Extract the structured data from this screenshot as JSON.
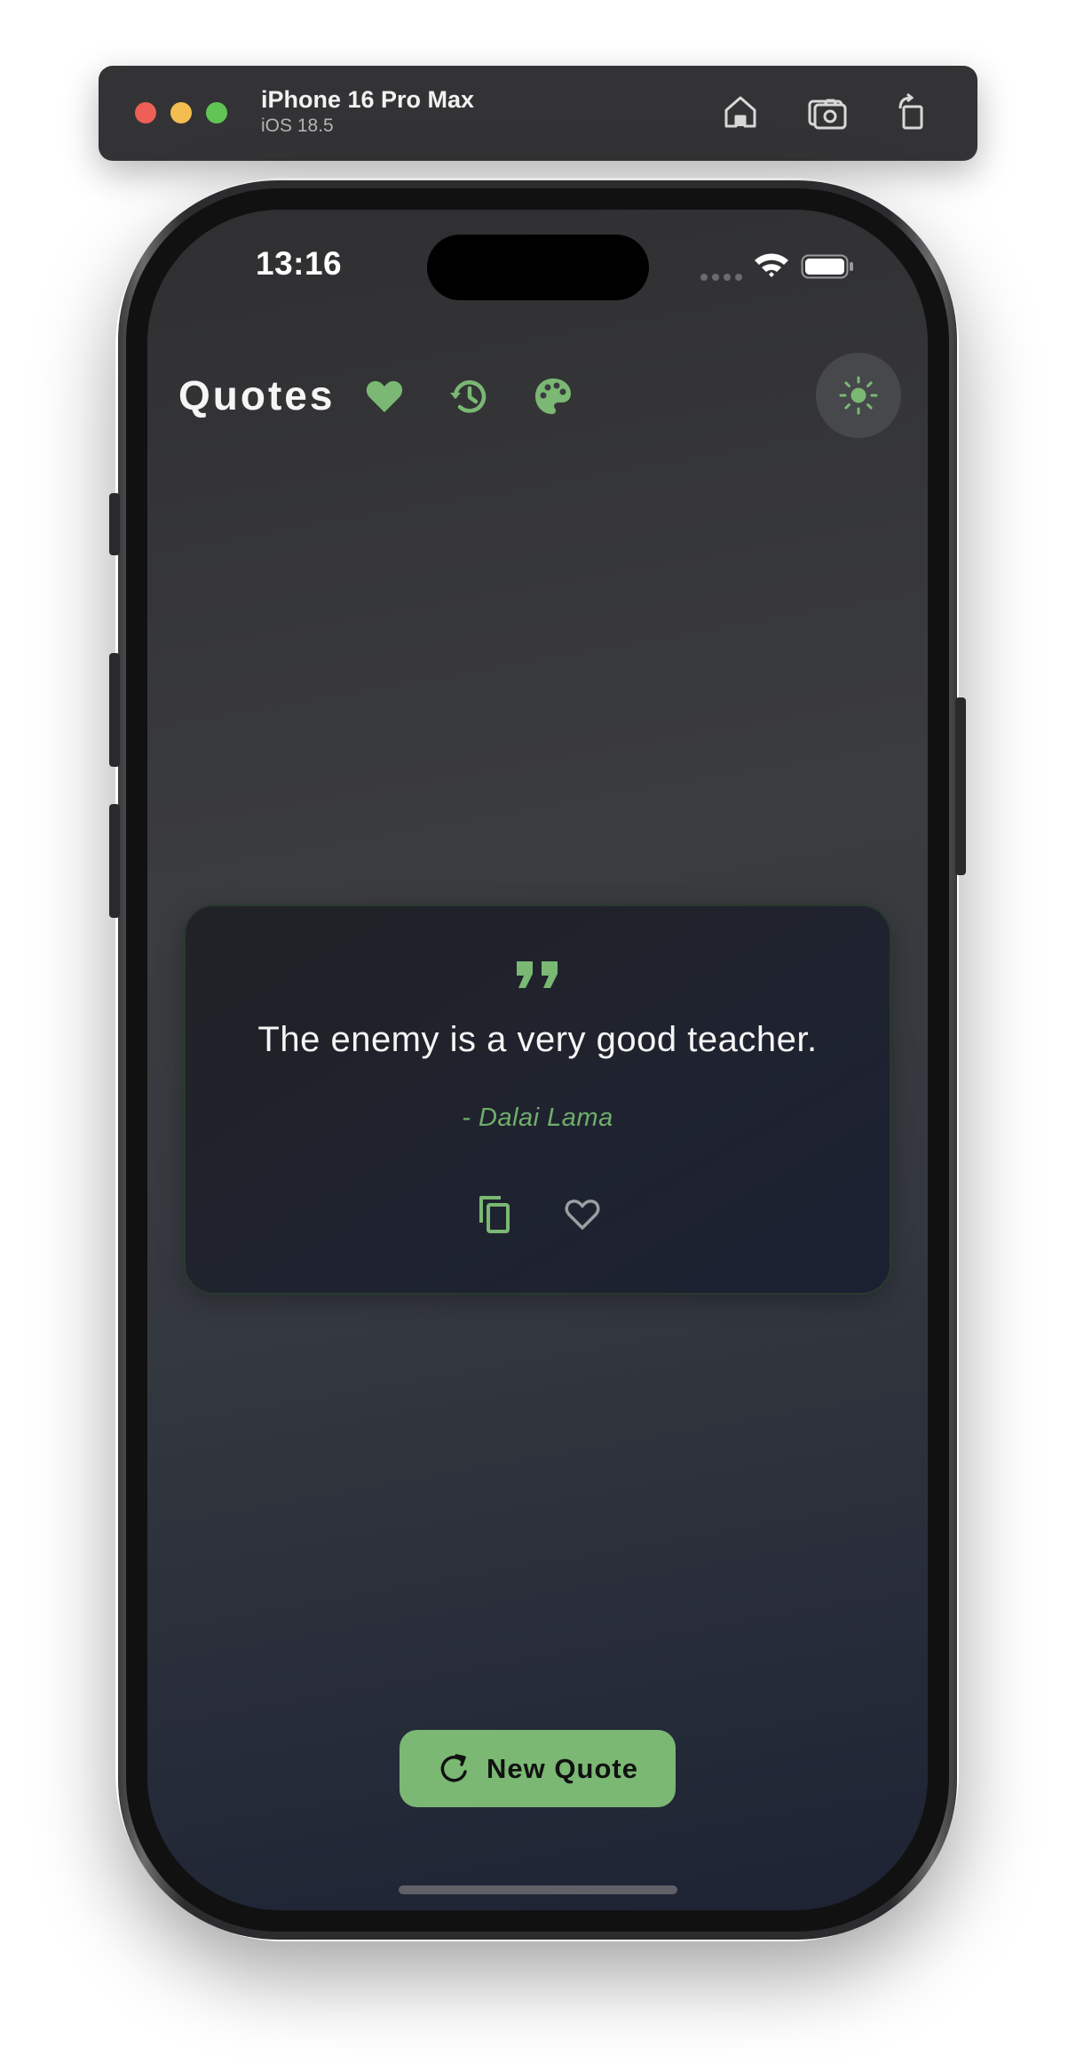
{
  "simulator": {
    "device_name": "iPhone 16 Pro Max",
    "os_version": "iOS 18.5",
    "icons": [
      "home-icon",
      "screenshot-icon",
      "rotate-icon"
    ]
  },
  "status_bar": {
    "time": "13:16",
    "icons": [
      "cellular-signal-icon",
      "wifi-icon",
      "battery-icon"
    ]
  },
  "header": {
    "title": "Quotes",
    "icons": [
      "favorites-heart-icon",
      "history-icon",
      "palette-icon",
      "theme-sun-icon"
    ]
  },
  "quote": {
    "text": "The enemy is a very good teacher.",
    "author": "- Dalai Lama",
    "actions": [
      "copy-icon",
      "favorite-outline-icon"
    ]
  },
  "new_quote_button": {
    "label": "New Quote"
  },
  "colors": {
    "accent": "#7ab874",
    "author": "#6fae6b",
    "card_bg": "#1f2330",
    "screen_bg_top": "#2f2f31",
    "screen_bg_bottom": "#1d2334"
  }
}
